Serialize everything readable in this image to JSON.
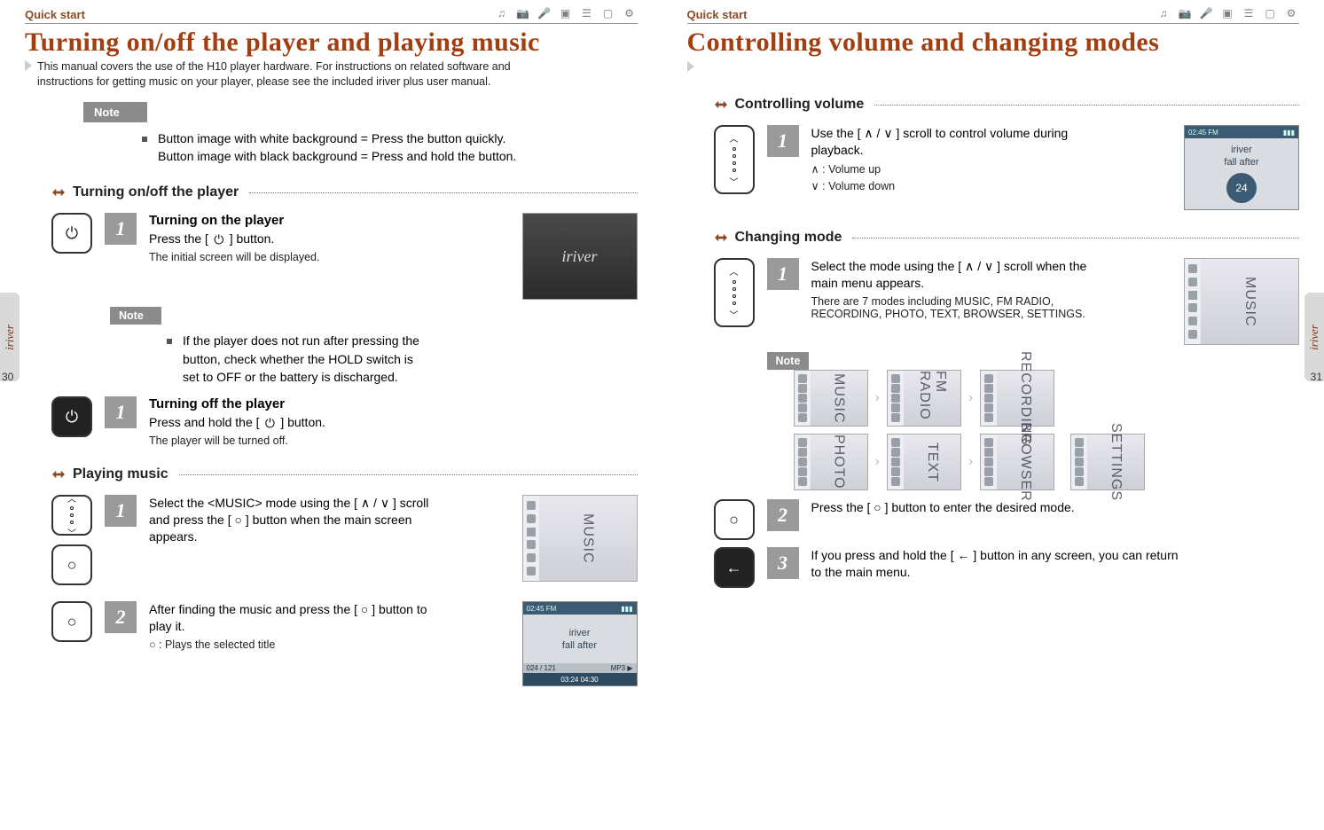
{
  "header": {
    "quickstart": "Quick start"
  },
  "left": {
    "title": "Turning on/off the player and playing music",
    "subtitle": "This manual covers the use of the H10 player hardware. For instructions on related software and instructions for getting music on your player, please see the included iriver plus user manual.",
    "note_label": "Note",
    "note_items": [
      "Button image with white background = Press the button quickly.",
      "Button image with black background = Press and hold the button."
    ],
    "sec_power": "Turning on/off the player",
    "power_on": {
      "num": "1",
      "title": "Turning on the player",
      "text_pre": "Press the [",
      "text_post": "] button.",
      "sub": "The initial screen will be displayed."
    },
    "power_note_label": "Note",
    "power_note_items": [
      "If the player does not run after pressing the button, check whether the HOLD switch is set to OFF or the battery is discharged."
    ],
    "power_off": {
      "num": "1",
      "title": "Turning off the player",
      "text_pre": "Press and hold the [",
      "text_post": "] button.",
      "sub": "The player will be turned off."
    },
    "sec_music": "Playing music",
    "music_step1": {
      "num": "1",
      "text": "Select the <MUSIC> mode using the [ ∧ / ∨ ] scroll and press the [ ○ ] button when the main screen appears."
    },
    "music_step2": {
      "num": "2",
      "text": "After finding the music and press the [ ○ ] button to play it.",
      "sub": "○  : Plays the selected title"
    },
    "lcd": {
      "top": "02:45 FM",
      "line1": "iriver",
      "line2": "fall after",
      "foot1": "024 / 121",
      "foot2": "03:24  04:30"
    },
    "screen_brand": "iriver",
    "pgnum": "30",
    "side": "iriver"
  },
  "right": {
    "title": "Controlling volume and changing modes",
    "sec_vol": "Controlling volume",
    "vol_step": {
      "num": "1",
      "text": "Use the [ ∧ / ∨ ] scroll to control volume during playback.",
      "sub1": "∧ : Volume up",
      "sub2": "∨ : Volume down"
    },
    "lcd": {
      "top": "02:45 FM",
      "line1": "iriver",
      "line2": "fall after",
      "badge": "24"
    },
    "sec_mode": "Changing mode",
    "mode_step1": {
      "num": "1",
      "text": "Select the mode using the [ ∧ / ∨ ] scroll when the main menu appears.",
      "sub": "There are 7 modes including MUSIC, FM RADIO, RECORDING, PHOTO, TEXT, BROWSER, SETTINGS."
    },
    "note_label": "Note",
    "modes": [
      "MUSIC",
      "FM RADIO",
      "RECORDING",
      "PHOTO",
      "TEXT",
      "BROWSER",
      "SETTINGS"
    ],
    "mode_step2": {
      "num": "2",
      "text": "Press the [ ○ ] button to enter the desired mode."
    },
    "mode_step3": {
      "num": "3",
      "text": "If you press and hold the [ ← ] button in any screen, you can return to the main menu."
    },
    "pgnum": "31",
    "side": "iriver"
  }
}
